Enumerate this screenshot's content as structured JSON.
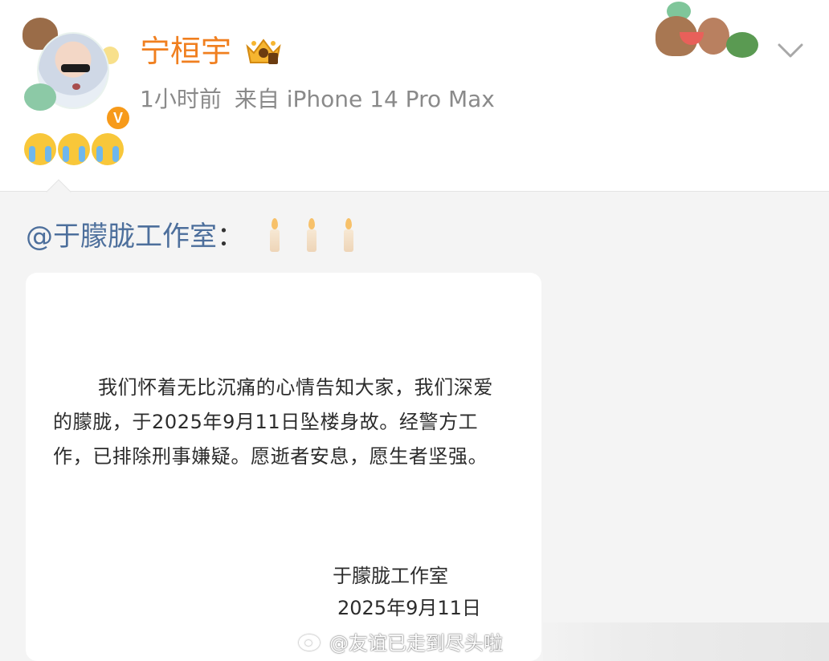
{
  "header": {
    "username": "宁桓宇",
    "time": "1小时前",
    "source": "来自 iPhone 14 Pro Max",
    "emojis": [
      "crying-face",
      "crying-face",
      "crying-face"
    ],
    "verify_mark": "V"
  },
  "repost": {
    "mention": "@于朦胧工作室",
    "colon": "：",
    "candles": [
      "candle",
      "candle",
      "candle"
    ]
  },
  "statement": {
    "body": "我们怀着无比沉痛的心情告知大家，我们深爱的朦胧，于2025年9月11日坠楼身故。经警方工作，已排除刑事嫌疑。愿逝者安息，愿生者坚强。",
    "signature": "于朦胧工作室",
    "date": "2025年9月11日"
  },
  "watermark": {
    "text": "@友谊已走到尽头啦"
  },
  "colors": {
    "username": "#f07f1f",
    "mention_link": "#4d6f9c",
    "meta_text": "#8a8a8a",
    "repost_bg": "#f4f4f4"
  }
}
